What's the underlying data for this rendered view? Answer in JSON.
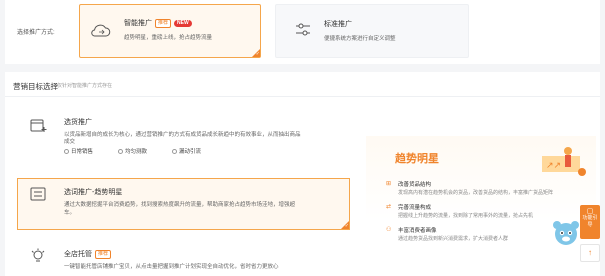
{
  "promo_mode": {
    "label": "选择推广方式:",
    "smart": {
      "title": "智能推广",
      "tag_recommend": "推荐",
      "tag_new": "NEW",
      "desc": "趋势明星，重磅上线，抢占趋势流量"
    },
    "standard": {
      "title": "标准推广",
      "desc": "便捷系统方案进行自定义调整"
    }
  },
  "goal_section": {
    "title": "营销目标选择",
    "subtitle": "仅针对智能推广方式存在",
    "options": [
      {
        "title": "选货推广",
        "desc_lines": [
          "以货品新增自的成长为核心，通过营销推广的方式有成货品成长新趋中的有效事业，从而抽出商品",
          "成交"
        ],
        "radios": [
          "日常销售",
          "均匀测款",
          "漏动引流"
        ]
      },
      {
        "title": "选词推广-趋势明星",
        "desc_lines": [
          "通过大数据挖掘平台消费趋势，找到搜索热度飙升的流量，帮助商家抢占趋势市场洼地，增强超",
          "车。"
        ]
      },
      {
        "title": "全店托管",
        "tag": "推荐",
        "desc_lines": [
          "一键智能托管店铺推广宝贝，从点击量把握到推广计划实现全自动优化，省时省力更放心"
        ]
      }
    ]
  },
  "trend_card": {
    "title": "趋势明星",
    "features": [
      {
        "title": "改善货品结构",
        "desc": "发现高内有潜在趋势机会的货品，改善货品的结构，丰富推广货品矩阵"
      },
      {
        "title": "完善流量构成",
        "desc": "把握线上升趋势的流量，找到除了常用事外的流量，抢占先机"
      },
      {
        "title": "丰富消费者画像",
        "desc": "通过趋势货品找到新兴消费需求，扩大消费者人群"
      }
    ]
  },
  "side": {
    "help_label": "功能引导",
    "top_arrow": "↑"
  },
  "colors": {
    "accent": "#f0842c",
    "accent_bg": "#fff8ef",
    "new_tag": "#e53935"
  }
}
